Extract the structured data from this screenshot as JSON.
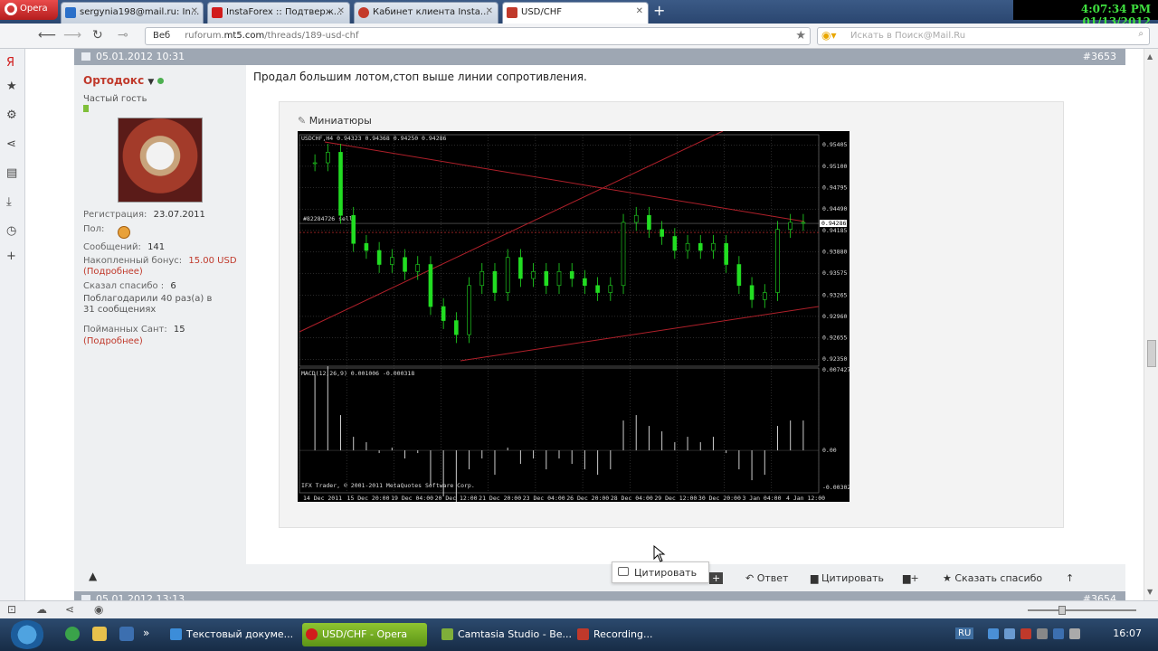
{
  "browser": {
    "opera_label": "Opera",
    "tabs": [
      {
        "label": "sergynia198@mail.ru: In...",
        "color": "#2b70c9"
      },
      {
        "label": "InstaForex :: Подтверж...",
        "color": "#d11c1c"
      },
      {
        "label": "Кабинет клиента Insta...",
        "color": "#c43a2a"
      },
      {
        "label": "USD/CHF",
        "color": "#c0392b"
      }
    ],
    "clock": "4:07:34 PM 01/13/2012",
    "address": {
      "scheme_label": "Веб",
      "prefix": "ruforum.",
      "domain": "mt5.com",
      "path": "/threads/189-usd-chf"
    },
    "search_placeholder": "Искать в Поиск@Mail.Ru"
  },
  "post": {
    "date": "05.01.2012 10:31",
    "number": "#3653",
    "author": {
      "name": "Ортодокс",
      "rank": "Частый гость",
      "registration_label": "Регистрация:",
      "registration_value": "23.07.2011",
      "gender_label": "Пол:",
      "messages_label": "Сообщений:",
      "messages_value": "141",
      "bonus_label": "Накопленный бонус:",
      "bonus_value": "15.00 USD",
      "more_link": "(Подробнее)",
      "thanks_label": "Сказал спасибо :",
      "thanks_value": "6",
      "thanked_text_1": "Поблагодарили 40 раз(а) в",
      "thanked_text_2": "31 сообщениях",
      "santa_label": "Пойманных Сант:",
      "santa_value": "15",
      "more_link_2": "(Подробнее)"
    },
    "message": "Продал большим лотом,стоп выше линии сопротивления.",
    "attachments_label": "Миниатюры",
    "footer": {
      "quote_popup": "Цитировать",
      "reply": "Ответ",
      "quote": "Цитировать",
      "thanks": "Сказать спасибо"
    }
  },
  "next_post": {
    "date": "05.01.2012 13:13",
    "number": "#3654"
  },
  "chart_data": {
    "type": "candlestick",
    "title": "USDCHF,H4  0.94323 0.94368 0.94250 0.94286",
    "order_label": "#82284726 sell",
    "price_axis": [
      "0.95405",
      "0.95100",
      "0.94795",
      "0.94490",
      "0.94185",
      "0.93880",
      "0.93575",
      "0.93265",
      "0.92960",
      "0.92655",
      "0.92350"
    ],
    "current_price": "0.94286",
    "macd_label": "MACD(12,26,9) 0.001006 -0.000318",
    "macd_axis": [
      "0.007427",
      "0.00",
      "-0.00302"
    ],
    "copyright": "IFX Trader, © 2001-2011 MetaQuotes Software Corp.",
    "x_labels": [
      "14 Dec 2011",
      "15 Dec 20:00",
      "19 Dec 04:00",
      "20 Dec 12:00",
      "21 Dec 20:00",
      "23 Dec 04:00",
      "26 Dec 20:00",
      "28 Dec 04:00",
      "29 Dec 12:00",
      "30 Dec 20:00",
      "3 Jan 04:00",
      "4 Jan 12:00"
    ],
    "closes": [
      0.9515,
      0.953,
      0.944,
      0.94,
      0.939,
      0.937,
      0.938,
      0.936,
      0.937,
      0.931,
      0.929,
      0.927,
      0.934,
      0.936,
      0.933,
      0.938,
      0.935,
      0.936,
      0.934,
      0.936,
      0.935,
      0.934,
      0.933,
      0.934,
      0.943,
      0.944,
      0.942,
      0.941,
      0.939,
      0.94,
      0.939,
      0.94,
      0.937,
      0.934,
      0.932,
      0.933,
      0.942,
      0.943,
      0.943
    ]
  },
  "statusbar": {},
  "taskbar": {
    "items": [
      {
        "label": "Текстовый докуме...",
        "color": "#3c8dd9"
      },
      {
        "label": "USD/CHF - Opera",
        "color": "#d11c1c"
      },
      {
        "label": "Camtasia Studio - Be...",
        "color": "#7fae3a"
      },
      {
        "label": "Recording...",
        "color": "#c0392b"
      }
    ],
    "lang": "RU",
    "time": "16:07"
  }
}
